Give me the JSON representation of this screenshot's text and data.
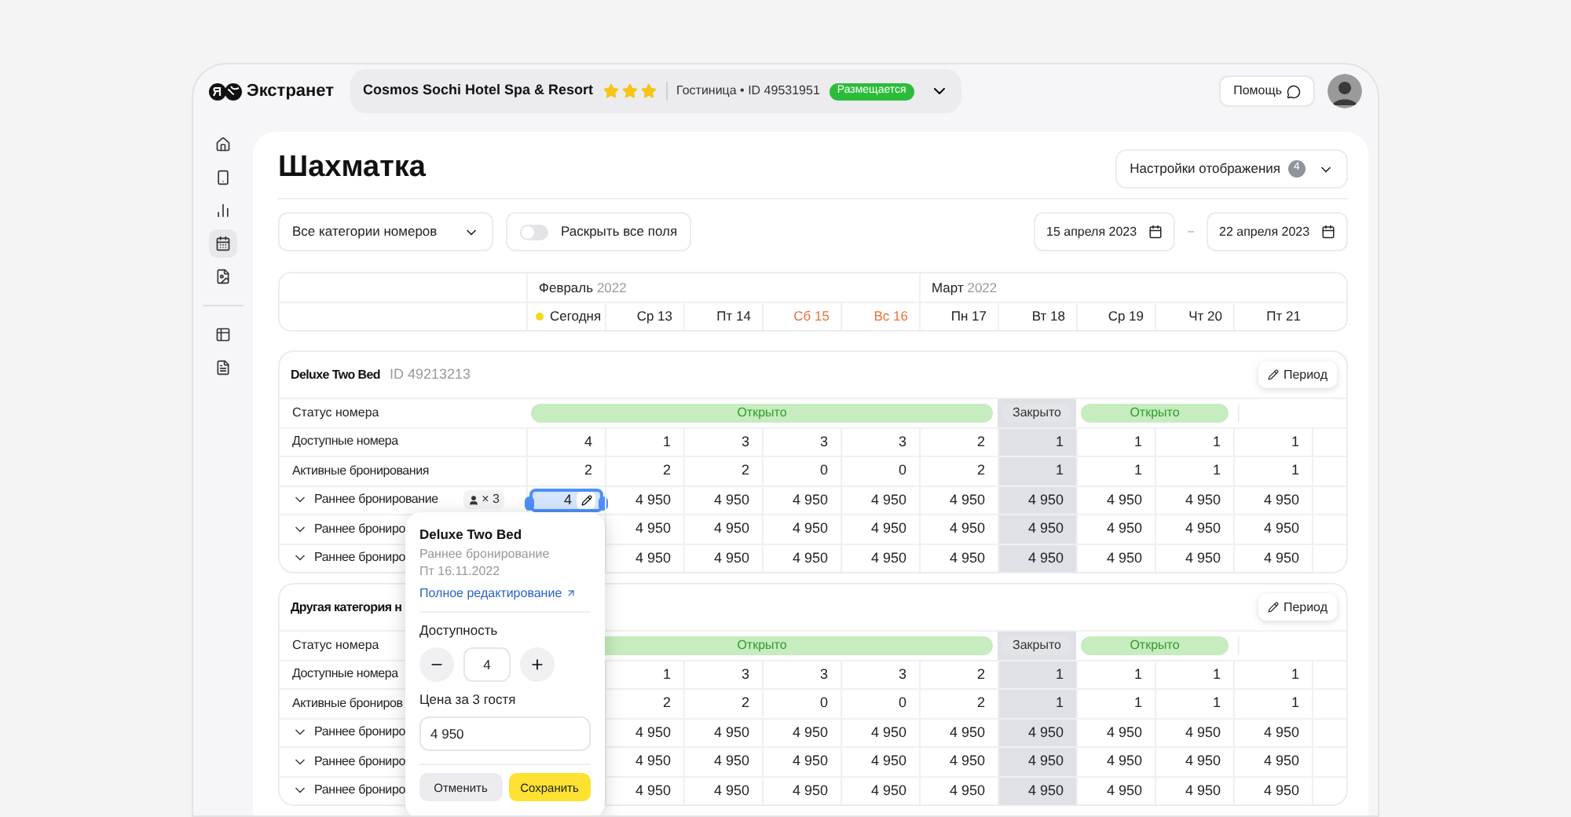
{
  "header": {
    "logo": "Экстранет",
    "hotel": {
      "name": "Cosmos Sochi Hotel Spa & Resort",
      "stars": 3,
      "info": "Гостиница • ID 49531951",
      "badge": "Размещается"
    },
    "help": "Помощь"
  },
  "sidebar": {
    "items": [
      {
        "selected": false
      },
      {
        "selected": false
      },
      {
        "selected": false
      },
      {
        "selected": true
      },
      {
        "selected": false
      },
      {
        "selected": false
      },
      {
        "selected": false
      }
    ]
  },
  "page": {
    "title": "Шахматка",
    "settings": {
      "label": "Настройки отображения",
      "count": "4"
    }
  },
  "filters": {
    "category": "Все категории номеров",
    "toggle": {
      "label": "Раскрыть все поля",
      "on": false
    },
    "date_from": "15 апреля 2023",
    "date_to": "22 апреля 2023"
  },
  "days": [
    {
      "label": "Сегодня",
      "today": true,
      "weekend": false,
      "closed": false,
      "month": {
        "name": "Февраль",
        "year": "2022"
      }
    },
    {
      "label": "Ср 13",
      "today": false,
      "weekend": false,
      "closed": false
    },
    {
      "label": "Пт 14",
      "today": false,
      "weekend": false,
      "closed": false
    },
    {
      "label": "Сб 15",
      "today": false,
      "weekend": true,
      "closed": false
    },
    {
      "label": "Вс 16",
      "today": false,
      "weekend": true,
      "closed": false
    },
    {
      "label": "Пн 17",
      "today": false,
      "weekend": false,
      "closed": false,
      "month": {
        "name": "Март",
        "year": "2022"
      }
    },
    {
      "label": "Вт 18",
      "today": false,
      "weekend": false,
      "closed": true
    },
    {
      "label": "Ср 19",
      "today": false,
      "weekend": false,
      "closed": false
    },
    {
      "label": "Чт 20",
      "today": false,
      "weekend": false,
      "closed": false
    },
    {
      "label": "Пт 21",
      "today": false,
      "weekend": false,
      "closed": false
    }
  ],
  "sections": [
    {
      "title": "Deluxe Two Bed",
      "id": "ID 49213213",
      "period": "Период",
      "rows": [
        {
          "kind": "status",
          "label": "Статус номера",
          "cells": [
            {
              "kind": "open",
              "label": "Открыто"
            },
            {
              "kind": "open"
            },
            {
              "kind": "open"
            },
            {
              "kind": "open"
            },
            {
              "kind": "open"
            },
            {
              "kind": "open"
            },
            {
              "kind": "closed",
              "label": "Закрыто"
            },
            {
              "kind": "open",
              "label": "Открыто"
            },
            {
              "kind": "open"
            },
            {
              "kind": "empty"
            },
            {
              "kind": "empty"
            }
          ]
        },
        {
          "kind": "count",
          "label": "Доступные номера",
          "cells": [
            "4",
            "1",
            "3",
            "3",
            "3",
            "2",
            "1",
            "1",
            "1",
            "1"
          ]
        },
        {
          "kind": "count",
          "label": "Активные бронирования",
          "cells": [
            "2",
            "2",
            "2",
            "0",
            "0",
            "2",
            "1",
            "1",
            "1",
            "1"
          ]
        },
        {
          "kind": "price",
          "label": "Раннее бронирование",
          "guests": "× 3",
          "cells": [
            {
              "value": "4",
              "selected": true
            },
            {
              "value": "4 950",
              "selected": false
            },
            {
              "value": "4 950",
              "selected": false
            },
            {
              "value": "4 950",
              "selected": false
            },
            {
              "value": "4 950",
              "selected": false
            },
            {
              "value": "4 950",
              "selected": false
            },
            {
              "value": "4 950",
              "selected": false
            },
            {
              "value": "4 950",
              "selected": false
            },
            {
              "value": "4 950",
              "selected": false
            },
            {
              "value": "4 950",
              "selected": false
            }
          ]
        },
        {
          "kind": "price",
          "label": "Раннее брониро",
          "cells": [
            null,
            {
              "value": "4 950",
              "selected": false
            },
            {
              "value": "4 950",
              "selected": false
            },
            {
              "value": "4 950",
              "selected": false
            },
            {
              "value": "4 950",
              "selected": false
            },
            {
              "value": "4 950",
              "selected": false
            },
            {
              "value": "4 950",
              "selected": false
            },
            {
              "value": "4 950",
              "selected": false
            },
            {
              "value": "4 950",
              "selected": false
            },
            {
              "value": "4 950",
              "selected": false
            }
          ]
        },
        {
          "kind": "price",
          "label": "Раннее брониро",
          "cells": [
            null,
            {
              "value": "4 950",
              "selected": false
            },
            {
              "value": "4 950",
              "selected": false
            },
            {
              "value": "4 950",
              "selected": false
            },
            {
              "value": "4 950",
              "selected": false
            },
            {
              "value": "4 950",
              "selected": false
            },
            {
              "value": "4 950",
              "selected": false
            },
            {
              "value": "4 950",
              "selected": false
            },
            {
              "value": "4 950",
              "selected": false
            },
            {
              "value": "4 950",
              "selected": false
            }
          ]
        }
      ]
    },
    {
      "title": "Другая категория н",
      "period": "Период",
      "rows": [
        {
          "kind": "status",
          "label": "Статус номера",
          "cells": [
            {
              "kind": "open",
              "label": "Открыто"
            },
            {
              "kind": "open"
            },
            {
              "kind": "open"
            },
            {
              "kind": "open"
            },
            {
              "kind": "open"
            },
            {
              "kind": "open"
            },
            {
              "kind": "closed",
              "label": "Закрыто"
            },
            {
              "kind": "open",
              "label": "Открыто"
            },
            {
              "kind": "open"
            },
            {
              "kind": "empty"
            },
            {
              "kind": "empty"
            }
          ]
        },
        {
          "kind": "count",
          "label": "Доступные номера",
          "cells": [
            null,
            "1",
            "3",
            "3",
            "3",
            "2",
            "1",
            "1",
            "1",
            "1"
          ]
        },
        {
          "kind": "count",
          "label": "Активные брониров",
          "cells": [
            null,
            "2",
            "2",
            "0",
            "0",
            "2",
            "1",
            "1",
            "1",
            "1"
          ]
        },
        {
          "kind": "price",
          "label": "Раннее брониро",
          "cells": [
            null,
            {
              "value": "4 950",
              "selected": false
            },
            {
              "value": "4 950",
              "selected": false
            },
            {
              "value": "4 950",
              "selected": false
            },
            {
              "value": "4 950",
              "selected": false
            },
            {
              "value": "4 950",
              "selected": false
            },
            {
              "value": "4 950",
              "selected": false
            },
            {
              "value": "4 950",
              "selected": false
            },
            {
              "value": "4 950",
              "selected": false
            },
            {
              "value": "4 950",
              "selected": false
            }
          ]
        },
        {
          "kind": "price",
          "label": "Раннее брониро",
          "cells": [
            null,
            {
              "value": "4 950",
              "selected": false
            },
            {
              "value": "4 950",
              "selected": false
            },
            {
              "value": "4 950",
              "selected": false
            },
            {
              "value": "4 950",
              "selected": false
            },
            {
              "value": "4 950",
              "selected": false
            },
            {
              "value": "4 950",
              "selected": false
            },
            {
              "value": "4 950",
              "selected": false
            },
            {
              "value": "4 950",
              "selected": false
            },
            {
              "value": "4 950",
              "selected": false
            }
          ]
        },
        {
          "kind": "price",
          "label": "Раннее брониро",
          "cells": [
            null,
            {
              "value": "4 950",
              "selected": false
            },
            {
              "value": "4 950",
              "selected": false
            },
            {
              "value": "4 950",
              "selected": false
            },
            {
              "value": "4 950",
              "selected": false
            },
            {
              "value": "4 950",
              "selected": false
            },
            {
              "value": "4 950",
              "selected": false
            },
            {
              "value": "4 950",
              "selected": false
            },
            {
              "value": "4 950",
              "selected": false
            },
            {
              "value": "4 950",
              "selected": false
            }
          ]
        }
      ]
    }
  ],
  "popover": {
    "title": "Deluxe Two Bed",
    "subtitle": "Раннее бронирование",
    "date": "Пт 16.11.2022",
    "link": "Полное редактирование",
    "availability_label": "Доступность",
    "availability": "4",
    "price_label": "Цена за 3 гостя",
    "price": "4 950",
    "cancel": "Отменить",
    "save": "Сохранить"
  }
}
